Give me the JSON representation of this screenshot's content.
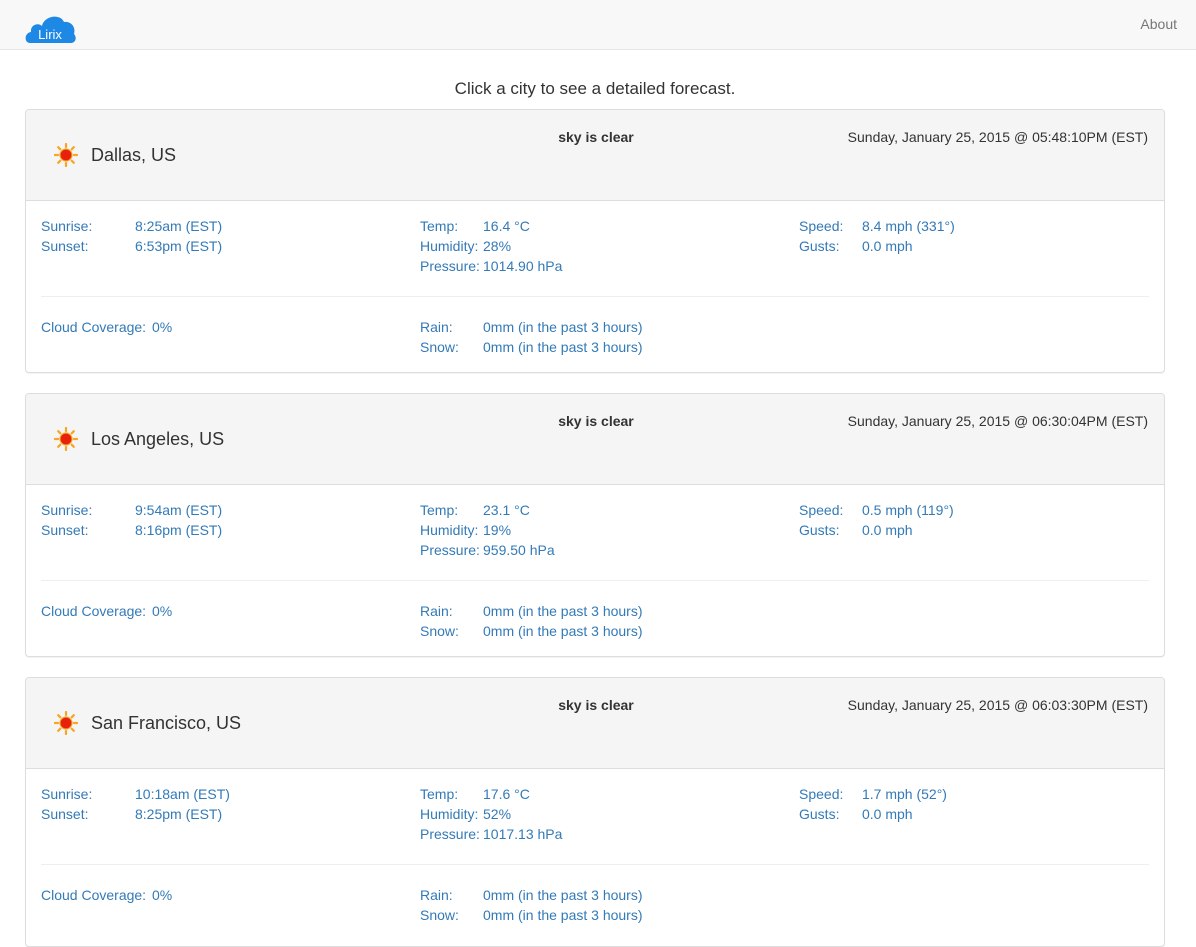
{
  "navbar": {
    "brand": "Lirix",
    "about": "About"
  },
  "instruction": "Click a city to see a detailed forecast.",
  "labels": {
    "sunrise": "Sunrise:",
    "sunset": "Sunset:",
    "temp": "Temp:",
    "humidity": "Humidity:",
    "pressure": "Pressure:",
    "speed": "Speed:",
    "gusts": "Gusts:",
    "cloud": "Cloud Coverage:",
    "rain": "Rain:",
    "snow": "Snow:"
  },
  "colors": {
    "link_blue": "#337ab7",
    "brand_blue": "#1e88e5",
    "panel_heading": "#f5f5f5",
    "sun_orange": "#f5a623",
    "sun_red": "#e8210c"
  },
  "icons": {
    "weather": "sun-icon",
    "brand": "cloud-logo"
  },
  "cities": [
    {
      "name": "Dallas, US",
      "condition": "sky is clear",
      "datetime": "Sunday, January 25, 2015 @ 05:48:10PM (EST)",
      "sunrise": "8:25am (EST)",
      "sunset": "6:53pm (EST)",
      "temp": "16.4 °C",
      "humidity": "28%",
      "pressure": "1014.90 hPa",
      "speed": "8.4 mph (331°)",
      "gusts": "0.0 mph",
      "cloud": "0%",
      "rain": "0mm (in the past 3 hours)",
      "snow": "0mm (in the past 3 hours)"
    },
    {
      "name": "Los Angeles, US",
      "condition": "sky is clear",
      "datetime": "Sunday, January 25, 2015 @ 06:30:04PM (EST)",
      "sunrise": "9:54am (EST)",
      "sunset": "8:16pm (EST)",
      "temp": "23.1 °C",
      "humidity": "19%",
      "pressure": "959.50 hPa",
      "speed": "0.5 mph (119°)",
      "gusts": "0.0 mph",
      "cloud": "0%",
      "rain": "0mm (in the past 3 hours)",
      "snow": "0mm (in the past 3 hours)"
    },
    {
      "name": "San Francisco, US",
      "condition": "sky is clear",
      "datetime": "Sunday, January 25, 2015 @ 06:03:30PM (EST)",
      "sunrise": "10:18am (EST)",
      "sunset": "8:25pm (EST)",
      "temp": "17.6 °C",
      "humidity": "52%",
      "pressure": "1017.13 hPa",
      "speed": "1.7 mph (52°)",
      "gusts": "0.0 mph",
      "cloud": "0%",
      "rain": "0mm (in the past 3 hours)",
      "snow": "0mm (in the past 3 hours)"
    }
  ]
}
